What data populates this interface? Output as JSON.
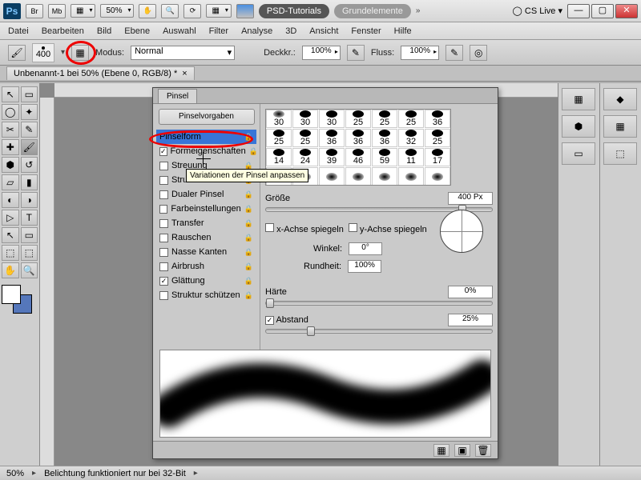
{
  "title": {
    "zoom": "50%",
    "tutorials": "PSD-Tutorials",
    "doc": "Grundelemente",
    "cslive": "CS Live"
  },
  "menu": [
    "Datei",
    "Bearbeiten",
    "Bild",
    "Ebene",
    "Auswahl",
    "Filter",
    "Analyse",
    "3D",
    "Ansicht",
    "Fenster",
    "Hilfe"
  ],
  "opt": {
    "size": "400",
    "mode_lbl": "Modus:",
    "mode": "Normal",
    "opac_lbl": "Deckkr.:",
    "opac": "100%",
    "flow_lbl": "Fluss:",
    "flow": "100%"
  },
  "doctab": "Unbenannt-1 bei 50% (Ebene 0, RGB/8) *",
  "panel": {
    "title": "Pinsel",
    "presets": "Pinselvorgaben",
    "items": [
      {
        "label": "Pinselform",
        "chk": false,
        "sel": true,
        "lock": true
      },
      {
        "label": "Formeigenschaften",
        "chk": true,
        "lock": true
      },
      {
        "label": "Streuung",
        "chk": false,
        "lock": true
      },
      {
        "label": "Struktur",
        "chk": false,
        "lock": true
      },
      {
        "label": "Dualer Pinsel",
        "chk": false,
        "lock": true
      },
      {
        "label": "Farbeinstellungen",
        "chk": false,
        "lock": true
      },
      {
        "label": "Transfer",
        "chk": false,
        "lock": true
      },
      {
        "label": "Rauschen",
        "chk": false,
        "lock": true
      },
      {
        "label": "Nasse Kanten",
        "chk": false,
        "lock": true
      },
      {
        "label": "Airbrush",
        "chk": false,
        "lock": true
      },
      {
        "label": "Glättung",
        "chk": true,
        "lock": true
      },
      {
        "label": "Struktur schützen",
        "chk": false,
        "lock": true
      }
    ],
    "thumbs": [
      30,
      30,
      30,
      25,
      25,
      25,
      36,
      25,
      25,
      36,
      36,
      36,
      32,
      25,
      14,
      24,
      39,
      46,
      59,
      11,
      17
    ],
    "size_lbl": "Größe",
    "size": "400 Px",
    "flipx": "x-Achse spiegeln",
    "flipy": "y-Achse spiegeln",
    "angle_lbl": "Winkel:",
    "angle": "0°",
    "round_lbl": "Rundheit:",
    "round": "100%",
    "hard_lbl": "Härte",
    "hard": "0%",
    "space_lbl": "Abstand",
    "space": "25%"
  },
  "tooltip": "Variationen der Pinsel anpassen",
  "status": {
    "zoom": "50%",
    "msg": "Belichtung funktioniert nur bei 32-Bit"
  }
}
